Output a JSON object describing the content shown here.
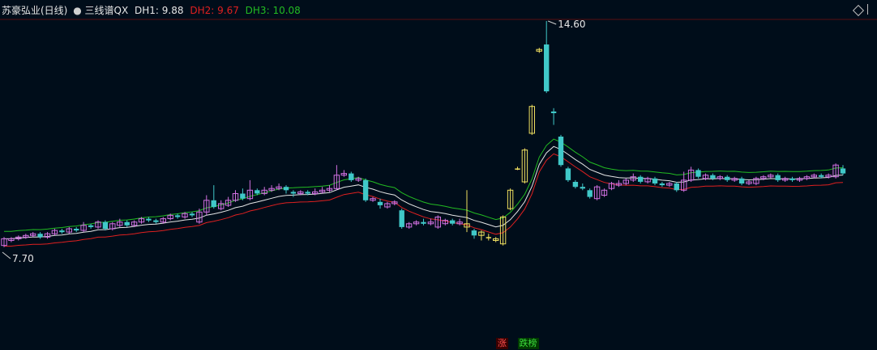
{
  "header": {
    "stock_name": "苏豪弘业(日线)",
    "indicator": "三线谱QX",
    "dh1_label": "DH1:",
    "dh1_value": "9.88",
    "dh2_label": "DH2:",
    "dh2_value": "9.67",
    "dh3_label": "DH3:",
    "dh3_value": "10.08",
    "colors": {
      "dh1": "#e6e6e6",
      "dh2": "#e02020",
      "dh3": "#22bb22"
    }
  },
  "bottom_tags": [
    {
      "label": "涨",
      "color": "#ff5050",
      "bg": "#3a0000"
    },
    {
      "label": "跌榜",
      "color": "#3ddc3d",
      "bg": "#003a00"
    }
  ],
  "colors": {
    "background": "#000d1a",
    "up": "#d070e0",
    "up_limit": "#f0e060",
    "down": "#40c8c8",
    "flat": "#708080",
    "line_white": "#e6e6e6",
    "line_red": "#e02020",
    "line_green": "#22bb22"
  },
  "chart_data": {
    "type": "candlestick",
    "annotations": [
      {
        "label": "14.60",
        "value": 14.6
      },
      {
        "label": "7.70",
        "value": 7.7
      }
    ],
    "candles": [
      [
        7.9,
        8.1,
        8.15,
        7.85
      ],
      [
        8.05,
        8.1,
        8.15,
        8.0
      ],
      [
        8.1,
        8.15,
        8.2,
        8.05
      ],
      [
        8.15,
        8.2,
        8.25,
        8.1
      ],
      [
        8.2,
        8.25,
        8.3,
        8.15
      ],
      [
        8.25,
        8.15,
        8.3,
        8.1
      ],
      [
        8.15,
        8.25,
        8.3,
        8.1
      ],
      [
        8.25,
        8.35,
        8.4,
        8.2
      ],
      [
        8.35,
        8.3,
        8.4,
        8.25
      ],
      [
        8.3,
        8.4,
        8.45,
        8.25
      ],
      [
        8.4,
        8.35,
        8.45,
        8.3
      ],
      [
        8.35,
        8.5,
        8.6,
        8.3
      ],
      [
        8.5,
        8.45,
        8.55,
        8.4
      ],
      [
        8.45,
        8.6,
        8.65,
        8.4
      ],
      [
        8.6,
        8.4,
        8.65,
        8.35
      ],
      [
        8.4,
        8.55,
        8.6,
        8.35
      ],
      [
        8.5,
        8.6,
        8.7,
        8.45
      ],
      [
        8.6,
        8.5,
        8.65,
        8.45
      ],
      [
        8.5,
        8.6,
        8.65,
        8.45
      ],
      [
        8.6,
        8.7,
        8.75,
        8.55
      ],
      [
        8.7,
        8.65,
        8.75,
        8.6
      ],
      [
        8.65,
        8.6,
        8.7,
        8.55
      ],
      [
        8.6,
        8.7,
        8.75,
        8.55
      ],
      [
        8.7,
        8.8,
        8.85,
        8.65
      ],
      [
        8.8,
        8.75,
        8.85,
        8.7
      ],
      [
        8.75,
        8.85,
        8.9,
        8.7
      ],
      [
        8.85,
        8.8,
        8.9,
        8.75
      ],
      [
        8.6,
        8.9,
        9.0,
        8.55
      ],
      [
        8.9,
        9.25,
        9.4,
        8.8
      ],
      [
        9.25,
        9.05,
        9.7,
        9.0
      ],
      [
        9.0,
        9.15,
        9.25,
        8.95
      ],
      [
        9.1,
        9.25,
        9.35,
        9.05
      ],
      [
        9.25,
        9.45,
        9.55,
        9.2
      ],
      [
        9.45,
        9.3,
        9.6,
        9.25
      ],
      [
        9.3,
        9.55,
        9.85,
        9.25
      ],
      [
        9.55,
        9.45,
        9.6,
        9.4
      ],
      [
        9.45,
        9.55,
        9.65,
        9.4
      ],
      [
        9.55,
        9.6,
        9.7,
        9.5
      ],
      [
        9.6,
        9.65,
        9.75,
        9.55
      ],
      [
        9.65,
        9.55,
        9.7,
        9.45
      ],
      [
        9.5,
        9.45,
        9.55,
        9.35
      ],
      [
        9.45,
        9.5,
        9.55,
        9.4
      ],
      [
        9.5,
        9.45,
        9.55,
        9.4
      ],
      [
        9.45,
        9.5,
        9.6,
        9.4
      ],
      [
        9.5,
        9.55,
        9.65,
        9.45
      ],
      [
        9.55,
        9.6,
        9.7,
        9.5
      ],
      [
        9.6,
        10.0,
        10.3,
        9.55
      ],
      [
        10.0,
        10.05,
        10.15,
        9.95
      ],
      [
        10.05,
        9.85,
        10.1,
        9.8
      ],
      [
        9.85,
        9.9,
        9.95,
        9.8
      ],
      [
        9.85,
        9.25,
        9.9,
        9.2
      ],
      [
        9.25,
        9.3,
        9.35,
        9.2
      ],
      [
        9.2,
        9.1,
        9.3,
        9.0
      ],
      [
        9.05,
        9.15,
        9.2,
        9.0
      ],
      [
        9.15,
        9.2,
        9.25,
        9.1
      ],
      [
        8.95,
        8.45,
        9.0,
        8.4
      ],
      [
        8.45,
        8.55,
        8.6,
        8.4
      ],
      [
        8.55,
        8.6,
        8.65,
        8.5
      ],
      [
        8.6,
        8.55,
        8.7,
        8.5
      ],
      [
        8.55,
        8.6,
        8.7,
        8.5
      ],
      [
        8.45,
        8.75,
        8.8,
        8.4
      ],
      [
        8.55,
        8.65,
        8.7,
        8.5
      ],
      [
        8.65,
        8.55,
        8.7,
        8.5
      ],
      [
        8.55,
        8.6,
        8.7,
        8.5
      ],
      [
        8.45,
        8.55,
        9.55,
        8.3
      ],
      [
        8.35,
        8.2,
        8.4,
        8.1
      ],
      [
        8.2,
        8.3,
        8.35,
        8.05
      ],
      [
        8.15,
        8.15,
        8.25,
        8.05
      ],
      [
        8.05,
        8.1,
        8.15,
        8.0
      ],
      [
        7.95,
        8.75,
        8.8,
        7.9
      ],
      [
        9.0,
        9.55,
        9.6,
        8.95
      ],
      [
        10.2,
        10.2,
        10.25,
        10.15
      ],
      [
        9.8,
        10.75,
        10.8,
        9.75
      ],
      [
        11.25,
        12.05,
        12.1,
        11.2
      ],
      [
        13.7,
        13.75,
        13.8,
        13.65
      ],
      [
        13.9,
        12.5,
        14.6,
        12.45
      ],
      [
        11.9,
        11.85,
        12.0,
        11.5
      ],
      [
        11.15,
        10.3,
        11.2,
        10.25
      ],
      [
        10.2,
        9.85,
        10.25,
        9.8
      ],
      [
        9.8,
        9.65,
        9.85,
        9.6
      ],
      [
        9.65,
        9.6,
        9.75,
        9.55
      ],
      [
        9.55,
        9.35,
        9.6,
        9.3
      ],
      [
        9.3,
        9.65,
        9.7,
        9.25
      ],
      [
        9.4,
        9.55,
        9.6,
        9.35
      ],
      [
        9.6,
        9.75,
        9.8,
        9.55
      ],
      [
        9.7,
        9.75,
        9.85,
        9.65
      ],
      [
        9.75,
        9.85,
        9.9,
        9.7
      ],
      [
        9.85,
        9.95,
        10.05,
        9.8
      ],
      [
        9.95,
        9.8,
        10.0,
        9.75
      ],
      [
        9.8,
        9.9,
        9.95,
        9.75
      ],
      [
        9.9,
        9.75,
        9.95,
        9.7
      ],
      [
        9.75,
        9.7,
        9.8,
        9.65
      ],
      [
        9.7,
        9.75,
        9.8,
        9.65
      ],
      [
        9.75,
        9.55,
        9.8,
        9.5
      ],
      [
        9.55,
        9.85,
        10.1,
        9.5
      ],
      [
        9.85,
        10.15,
        10.25,
        9.8
      ],
      [
        10.15,
        9.95,
        10.2,
        9.9
      ],
      [
        9.9,
        10.0,
        10.05,
        9.85
      ],
      [
        10.0,
        9.9,
        10.05,
        9.85
      ],
      [
        9.9,
        9.95,
        10.0,
        9.85
      ],
      [
        9.95,
        9.85,
        10.0,
        9.8
      ],
      [
        9.85,
        9.9,
        9.95,
        9.8
      ],
      [
        9.9,
        9.75,
        9.95,
        9.7
      ],
      [
        9.75,
        9.8,
        9.85,
        9.7
      ],
      [
        9.75,
        9.9,
        9.95,
        9.7
      ],
      [
        9.9,
        9.95,
        10.0,
        9.85
      ],
      [
        9.95,
        10.0,
        10.05,
        9.9
      ],
      [
        10.0,
        9.85,
        10.05,
        9.8
      ],
      [
        9.85,
        9.9,
        9.95,
        9.8
      ],
      [
        9.9,
        9.85,
        9.95,
        9.8
      ],
      [
        9.85,
        9.9,
        9.95,
        9.8
      ],
      [
        9.9,
        9.95,
        10.0,
        9.85
      ],
      [
        9.95,
        10.0,
        10.05,
        9.9
      ],
      [
        10.0,
        9.95,
        10.05,
        9.9
      ],
      [
        9.95,
        10.0,
        10.05,
        9.9
      ],
      [
        9.95,
        10.3,
        10.35,
        9.9
      ],
      [
        10.2,
        10.05,
        10.3,
        10.0
      ]
    ],
    "series": [
      {
        "name": "DH1"
      },
      {
        "name": "DH2"
      },
      {
        "name": "DH3"
      }
    ]
  }
}
